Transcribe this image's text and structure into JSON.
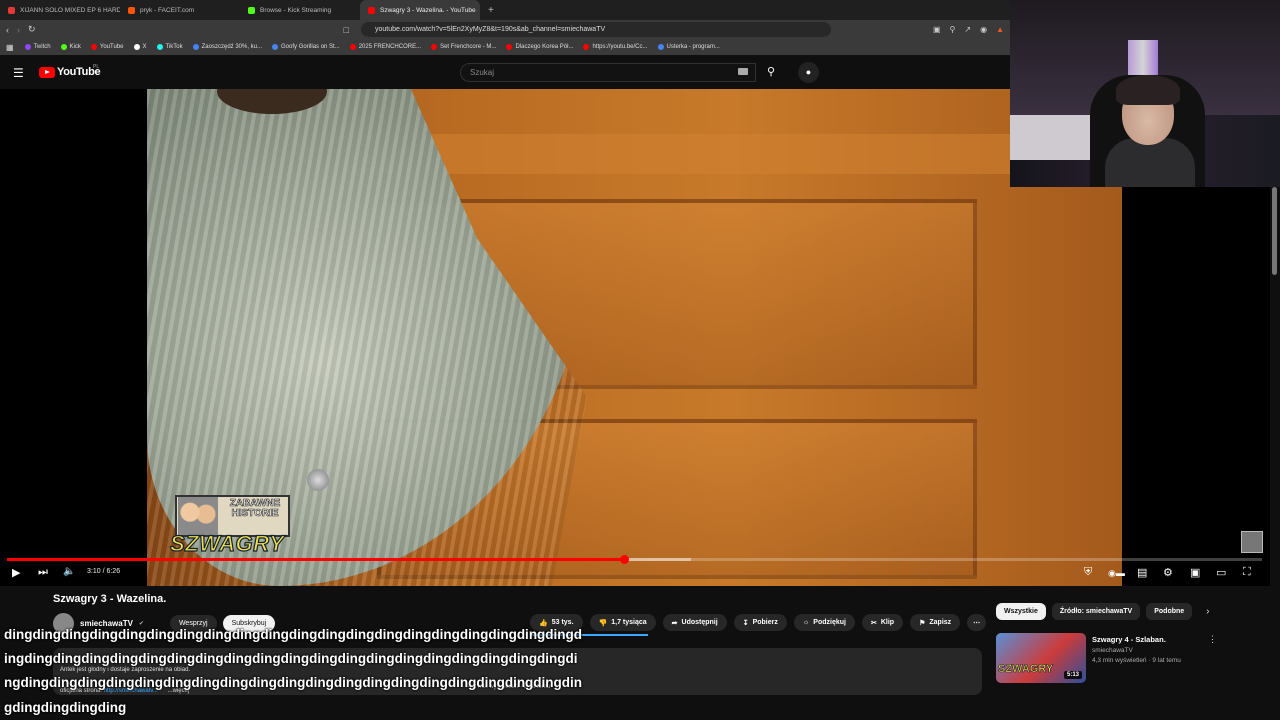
{
  "browser": {
    "tabs": [
      {
        "label": "XIJANN SOLO MIXED EP 6 HARD TE",
        "color": "#e53935",
        "active": false
      },
      {
        "label": "pryk - FACEIT.com",
        "color": "#ff5500",
        "active": false
      },
      {
        "label": "Browse - Kick Streaming",
        "color": "#53fc18",
        "active": false
      },
      {
        "label": "Szwagry 3 - Wazelina. - YouTube",
        "color": "#ff0000",
        "active": true
      }
    ],
    "url": "youtube.com/watch?v=5lEn2XyMyZ8&t=190s&ab_channel=smiechawaTV",
    "bookmarks": [
      {
        "label": "Twitch",
        "color": "#9146ff"
      },
      {
        "label": "Kick",
        "color": "#53fc18"
      },
      {
        "label": "YouTube",
        "color": "#ff0000"
      },
      {
        "label": "X",
        "color": "#ffffff"
      },
      {
        "label": "TikTok",
        "color": "#25f4ee"
      },
      {
        "label": "Zaoszczędź 30%, ku...",
        "color": "#4285f4"
      },
      {
        "label": "Goofy Gorillas on St...",
        "color": "#4285f4"
      },
      {
        "label": "2025 FRENCHCORE...",
        "color": "#ff0000"
      },
      {
        "label": "Set Frenchcore - M...",
        "color": "#ff0000"
      },
      {
        "label": "Dlaczego Korea Pół...",
        "color": "#ff0000"
      },
      {
        "label": "https://youtu.be/Cc...",
        "color": "#ff0000"
      },
      {
        "label": "Usterka - program...",
        "color": "#4285f4"
      }
    ]
  },
  "youtube": {
    "logo": "YouTube",
    "region": "PL",
    "search_placeholder": "Szukaj"
  },
  "player": {
    "time": "3:10 / 6:26",
    "progress_fraction": 0.492,
    "buffer_fraction": 0.545,
    "overlay_logo": {
      "top": "ZABAWNE HISTORIE",
      "main": "SZWAGRY"
    }
  },
  "video_info": {
    "title": "Szwagry 3 - Wazelina.",
    "channel": "smiechawaTV",
    "join_label": "Wesprzyj",
    "subscribe_label": "Subskrybuj",
    "likes": "53 tys.",
    "dislikes": "1,7 tysiąca",
    "share": "Udostępnij",
    "download": "Pobierz",
    "thanks": "Podziękuj",
    "clip": "Klip",
    "save": "Zapisz",
    "desc_line1": "Antek jest głodny i dostaje zaproszenie na obiad.",
    "desc_line2_prefix": "oficjalna strona: ",
    "desc_link": "http://smiechawatv...",
    "desc_more": "...więcej",
    "desc_views": "4,2 mln wyświetleń · 9 lat temu",
    "chat_overlay": "dingdingdingdingdingdingdingdingdingdingdingdingdingdingdingdingdingdingdingdingdingdingdingdingdingdingdingdingdingdingdingdingdingdingdingdingdingdingdingdingdingdingdingdingdingdingdingdingdingdingdingdingdingdingdingdingdingdingdingdingdingdingdingdingding"
  },
  "sidebar": {
    "chips": [
      "Wszystkie",
      "Źródło: smiechawaTV",
      "Podobne"
    ],
    "rec": {
      "title": "Szwagry 4 - Szlaban.",
      "channel": "smiechawaTV",
      "meta": "4,3 mln wyświetleń · 9 lat temu",
      "duration": "5:13",
      "thumb_text": "SZWAGRY"
    }
  }
}
